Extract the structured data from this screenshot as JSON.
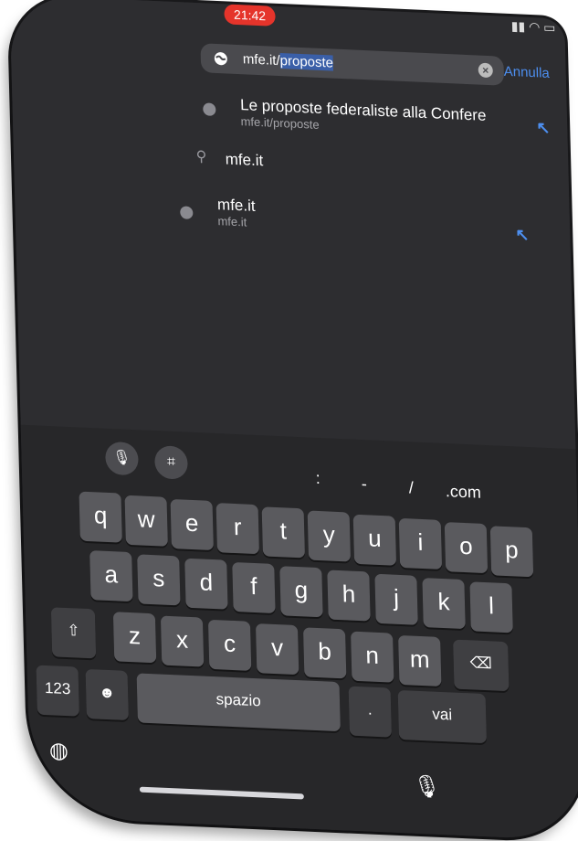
{
  "status": {
    "time": "21:42"
  },
  "address_bar": {
    "value_plain": "mfe.it/",
    "value_selected": "proposte",
    "cancel_label": "Annulla"
  },
  "suggestions": [
    {
      "title": "Le proposte federaliste alla Confere",
      "subtitle": "mfe.it/proposte"
    },
    {
      "title": "mfe.it"
    },
    {
      "title": "mfe.it",
      "subtitle": "mfe.it"
    }
  ],
  "keyboard": {
    "quick_keys": [
      ":",
      "-",
      "/",
      ".com"
    ],
    "row1": [
      "q",
      "w",
      "e",
      "r",
      "t",
      "y",
      "u",
      "i",
      "o",
      "p"
    ],
    "row2": [
      "a",
      "s",
      "d",
      "f",
      "g",
      "h",
      "j",
      "k",
      "l"
    ],
    "row3": [
      "z",
      "x",
      "c",
      "v",
      "b",
      "n",
      "m"
    ],
    "numbers_label": "123",
    "space_label": "spazio",
    "period_label": ".",
    "go_label": "vai"
  },
  "colors": {
    "accent": "#4d8ff0",
    "time_pill": "#e5342b"
  }
}
